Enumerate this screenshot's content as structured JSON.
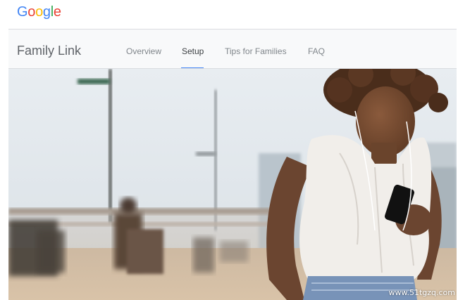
{
  "header": {
    "logo_letters": [
      {
        "char": "G",
        "color": "#4285F4"
      },
      {
        "char": "o",
        "color": "#EA4335"
      },
      {
        "char": "o",
        "color": "#FBBC05"
      },
      {
        "char": "g",
        "color": "#4285F4"
      },
      {
        "char": "l",
        "color": "#34A853"
      },
      {
        "char": "e",
        "color": "#EA4335"
      }
    ]
  },
  "nav": {
    "product_name": "Family Link",
    "tabs": [
      {
        "label": "Overview",
        "active": false
      },
      {
        "label": "Setup",
        "active": true
      },
      {
        "label": "Tips for Families",
        "active": false
      },
      {
        "label": "FAQ",
        "active": false
      }
    ],
    "accent_color": "#4285F4"
  },
  "hero": {
    "watermark": "www.51tgzq.com"
  }
}
